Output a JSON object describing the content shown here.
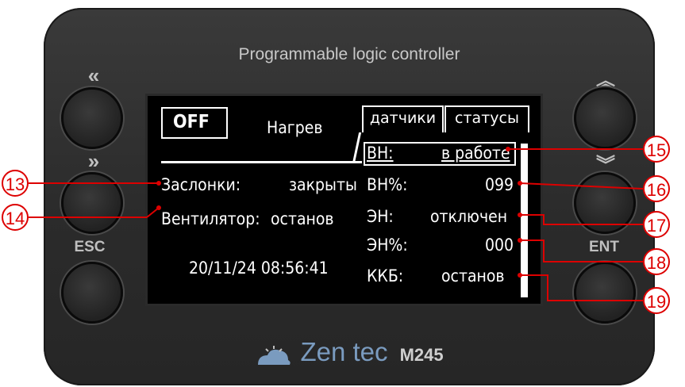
{
  "device": {
    "title": "Programmable logic controller",
    "brand": "Zen tec",
    "model": "M245"
  },
  "buttons": {
    "left_top_label": "«",
    "left_mid_label": "»",
    "left_bottom_label": "ESC",
    "right_top_label": "«",
    "right_mid_label": "»",
    "right_bottom_label": "ENT"
  },
  "screen": {
    "off_label": "OFF",
    "mode": "Нагрев",
    "tabs": [
      "датчики",
      "статусы"
    ],
    "left_rows": [
      {
        "label": "Заслонки:",
        "value": "закрыты"
      },
      {
        "label": "Вентилятор:",
        "value": "останов"
      }
    ],
    "datetime": "20/11/24 08:56:41",
    "status_rows": [
      {
        "label": "ВН:",
        "value": "в работе"
      },
      {
        "label": "ВН%:",
        "value": "099"
      },
      {
        "label": "ЭН:",
        "value": "отключен"
      },
      {
        "label": "ЭН%:",
        "value": "000"
      },
      {
        "label": "ККБ:",
        "value": "останов"
      }
    ]
  },
  "callouts": [
    "13",
    "14",
    "15",
    "16",
    "17",
    "18",
    "19"
  ],
  "colors": {
    "callout": "#d00000",
    "logo": "#7a9bbf",
    "lcd_bg": "#000000"
  }
}
